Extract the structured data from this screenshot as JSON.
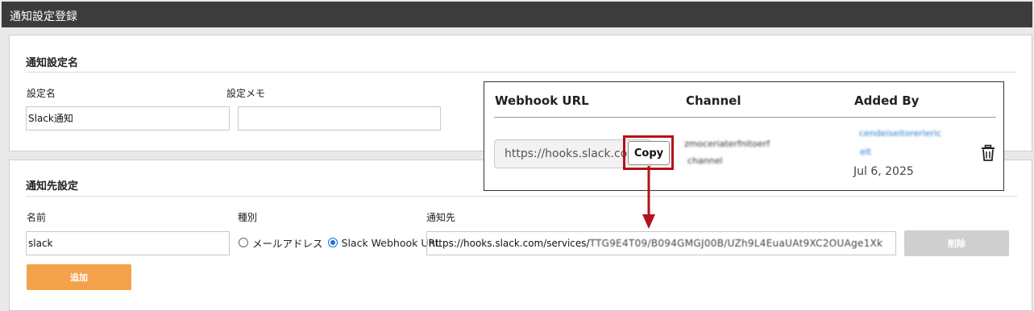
{
  "page": {
    "title": "通知設定登録"
  },
  "notify_name_section": {
    "title": "通知設定名",
    "name_label": "設定名",
    "name_value": "Slack通知",
    "memo_label": "設定メモ",
    "memo_value": ""
  },
  "destination_section": {
    "title": "通知先設定",
    "name_label": "名前",
    "name_value": "slack",
    "type_label": "種別",
    "type_options": [
      "メールアドレス",
      "Slack Webhook URL"
    ],
    "type_selected": "Slack Webhook URL",
    "dest_label": "通知先",
    "dest_value_visible": "https://hooks.slack.com/services/",
    "dest_value_obscured": "TTG9E4T09/B094GMGJ00B/UZh9L4EuaUAt9XC2OUAge1Xk",
    "add_label": "追加",
    "delete_label": "削除"
  },
  "webhook_popover": {
    "columns": [
      "Webhook URL",
      "Channel",
      "Added By"
    ],
    "url_value": "https://hooks.slack.com",
    "copy_label": "Copy",
    "channel_obscured": [
      "zmoceriaterfnitoerf",
      "channel"
    ],
    "added_by_obscured": [
      "cendeiseitorerleric",
      "elt"
    ],
    "added_date": "Jul 6, 2025"
  },
  "colors": {
    "titlebar": "#3c3c3c",
    "add_button": "#f4a14c",
    "delete_button": "#cfcfcf",
    "highlight": "#b4121b",
    "link_blue": "#2f7ad7"
  },
  "icons": {
    "delete_row": "trash-icon",
    "annotation": "arrow-down-icon"
  }
}
